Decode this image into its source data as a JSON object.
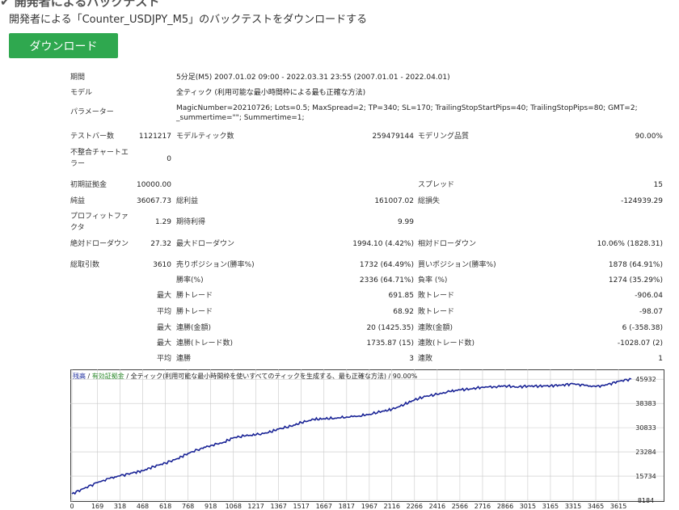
{
  "header": {
    "title": "✔ 開発者によるバックテスト",
    "subtitle": "開発者による「Counter_USDJPY_M5」のバックテストをダウンロードする",
    "download_label": "ダウンロード"
  },
  "report": {
    "period_label": "期間",
    "period_value": "5分足(M5) 2007.01.02 09:00 - 2022.03.31 23:55 (2007.01.01 - 2022.04.01)",
    "model_label": "モデル",
    "model_value": "全ティック (利用可能な最小時間枠による最も正確な方法)",
    "params_label": "パラメーター",
    "params_line1": "MagicNumber=20210726; Lots=0.5; MaxSpread=2; TP=340; SL=170; TrailingStopStartPips=40; TrailingStopPips=80; GMT=2;",
    "params_line2": "_summertime=\"\"; Summertime=1;",
    "bars_label": "テストバー数",
    "bars_value": "1121217",
    "ticks_label": "モデルティック数",
    "ticks_value": "259479144",
    "quality_label": "モデリング品質",
    "quality_value": "90.00%",
    "mismatch_label_1": "不整合チャートエ",
    "mismatch_label_2": "ラー",
    "mismatch_value": "0",
    "deposit_label": "初期証拠金",
    "deposit_value": "10000.00",
    "spread_label": "スプレッド",
    "spread_value": "15",
    "net_label": "純益",
    "net_value": "36067.73",
    "gross_profit_label": "総利益",
    "gross_profit_value": "161007.02",
    "gross_loss_label": "総損失",
    "gross_loss_value": "-124939.29",
    "pf_label_1": "プロフィットファ",
    "pf_label_2": "クタ",
    "pf_value": "1.29",
    "expected_label": "期待利得",
    "expected_value": "9.99",
    "abs_dd_label": "絶対ドローダウン",
    "abs_dd_value": "27.32",
    "max_dd_label": "最大ドローダウン",
    "max_dd_value": "1994.10 (4.42%)",
    "rel_dd_label": "相対ドローダウン",
    "rel_dd_value": "10.06% (1828.31)",
    "trades_label": "総取引数",
    "trades_value": "3610",
    "short_label": "売りポジション(勝率%)",
    "short_value": "1732 (64.49%)",
    "long_label": "買いポジション(勝率%)",
    "long_value": "1878 (64.91%)",
    "winrate_label": "勝率(%)",
    "winrate_value": "2336 (64.71%)",
    "lossrate_label": "負率 (%)",
    "lossrate_value": "1274 (35.29%)",
    "max_word": "最大",
    "avg_word": "平均",
    "max_win_label": "勝トレード",
    "max_win_value": "691.85",
    "max_loss_label": "敗トレード",
    "max_loss_value": "-906.04",
    "avg_win_label": "勝トレード",
    "avg_win_value": "68.92",
    "avg_loss_label": "敗トレード",
    "avg_loss_value": "-98.07",
    "cons_win_amt_label": "連勝(金額)",
    "cons_win_amt_value": "20 (1425.35)",
    "cons_loss_amt_label": "連敗(金額)",
    "cons_loss_amt_value": "6 (-358.38)",
    "cons_win_trd_label": "連勝(トレード数)",
    "cons_win_trd_value": "1735.87 (15)",
    "cons_loss_trd_label": "連敗(トレード数)",
    "cons_loss_trd_value": "-1028.07 (2)",
    "avg_cons_win_label": "連勝",
    "avg_cons_win_value": "3",
    "avg_cons_loss_label": "連敗",
    "avg_cons_loss_value": "1"
  },
  "chart_legend": {
    "balance": "残高",
    "sep1": " / ",
    "equity": "有効証拠金",
    "sep2": " / ",
    "desc": "全ティック(利用可能な最小時間枠を使いすべてのティックを生成する、最も正確な方法)",
    "quality": " / 90.00%"
  },
  "colors": {
    "line": "#1a2496",
    "grid": "#c8c8c8",
    "button": "#2fa84f"
  },
  "chart_data": {
    "type": "line",
    "title": "",
    "xlabel": "",
    "ylabel": "",
    "x_ticks": [
      "0",
      "169",
      "318",
      "468",
      "618",
      "768",
      "918",
      "1068",
      "1217",
      "1367",
      "1517",
      "1667",
      "1817",
      "1967",
      "2116",
      "2266",
      "2416",
      "2566",
      "2716",
      "2866",
      "3015",
      "3165",
      "3315",
      "3465",
      "3615"
    ],
    "y_ticks": [
      "45932",
      "38383",
      "30833",
      "23284",
      "15734",
      "8184"
    ],
    "ylim": [
      8184,
      48000
    ],
    "xlim": [
      0,
      3700
    ],
    "series": [
      {
        "values_x": [
          0,
          80,
          169,
          250,
          318,
          400,
          468,
          540,
          618,
          700,
          768,
          850,
          918,
          1000,
          1068,
          1150,
          1217,
          1300,
          1367,
          1450,
          1517,
          1600,
          1667,
          1740,
          1817,
          1900,
          1967,
          2050,
          2116,
          2200,
          2266,
          2340,
          2416,
          2500,
          2566,
          2640,
          2716,
          2800,
          2866,
          2940,
          3015,
          3090,
          3165,
          3240,
          3315,
          3390,
          3465,
          3540,
          3615,
          3700
        ],
        "values_y": [
          10200,
          11900,
          13700,
          15000,
          15800,
          16700,
          17400,
          18700,
          19800,
          21200,
          22800,
          24300,
          25300,
          26200,
          27700,
          28300,
          28600,
          29300,
          30400,
          31300,
          32400,
          33400,
          33600,
          33800,
          34200,
          34500,
          35000,
          35900,
          36500,
          38100,
          39500,
          40600,
          41200,
          42100,
          42600,
          42900,
          43500,
          43600,
          43900,
          43500,
          43800,
          43800,
          43900,
          44100,
          44500,
          44000,
          43600,
          44200,
          45300,
          46000
        ]
      }
    ]
  }
}
